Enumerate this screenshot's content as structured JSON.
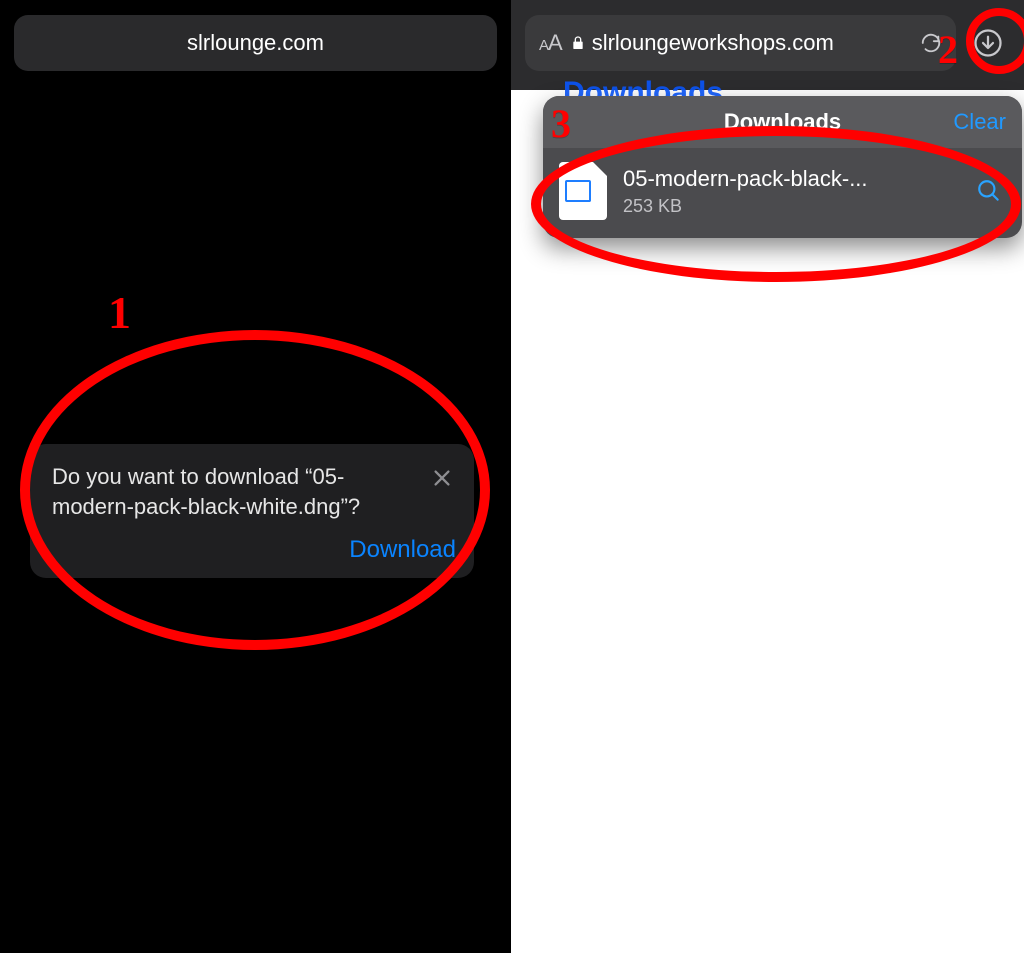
{
  "left": {
    "url": "slrlounge.com",
    "prompt": {
      "message": "Do you want to download “05-modern-pack-black-white.dng”?",
      "download_label": "Download"
    }
  },
  "right": {
    "url": "slrloungeworkshops.com",
    "page_heading_partial": "Downloads",
    "popover": {
      "title": "Downloads",
      "clear_label": "Clear",
      "items": [
        {
          "name": "05-modern-pack-black-...",
          "size": "253 KB"
        }
      ]
    }
  },
  "annotations": {
    "n1": "1",
    "n2": "2",
    "n3": "3"
  }
}
